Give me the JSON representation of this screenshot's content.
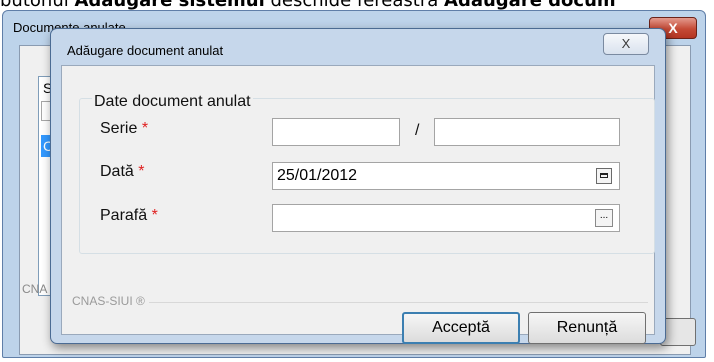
{
  "doc_caption": {
    "prefix": "butonul ",
    "bold1": "Adăugare sistemul",
    "middle": " deschide fereastra ",
    "bold2": "Adăugare docum"
  },
  "background_window": {
    "title": "Documente anulate",
    "close_symbol": "X",
    "list_header": "S",
    "selected_row": "C",
    "footer": "CNA"
  },
  "dialog": {
    "title": "Adăugare document anulat",
    "close_symbol": "X",
    "group_title": "Date document anulat",
    "fields": {
      "serie_label": "Serie",
      "serie_value": "",
      "numar_value": "",
      "separator": "/",
      "data_label": "Dată",
      "data_value": "25/01/2012",
      "parafa_label": "Parafă",
      "parafa_value": "",
      "required_mark": "*"
    },
    "footer_brand": "CNAS-SIUI ®",
    "buttons": {
      "accept": "Acceptă",
      "cancel": "Renunță"
    }
  }
}
